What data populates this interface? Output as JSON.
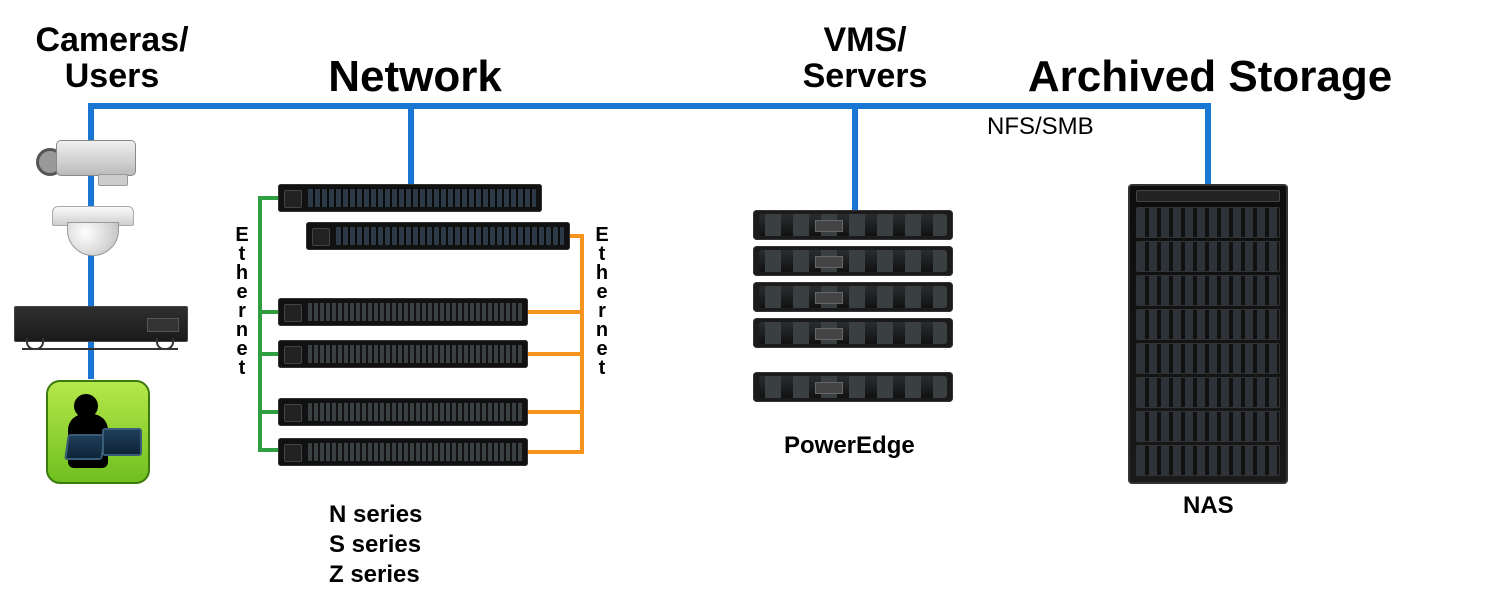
{
  "titles": {
    "cameras": "Cameras/\nUsers",
    "network": "Network",
    "vms": "VMS/\nServers",
    "storage": "Archived Storage"
  },
  "labels": {
    "ethernet_left": "E\nt\nh\ne\nr\nn\ne\nt",
    "ethernet_right": "E\nt\nh\ne\nr\nn\ne\nt",
    "poweredge": "PowerEdge",
    "nas": "NAS",
    "nfs_smb": "NFS/SMB"
  },
  "series": {
    "n": "N series",
    "s": "S series",
    "z": "Z series"
  },
  "colors": {
    "bus": "#1976d2",
    "ethernet_green": "#2e9e3e",
    "ethernet_orange": "#f7941d"
  }
}
